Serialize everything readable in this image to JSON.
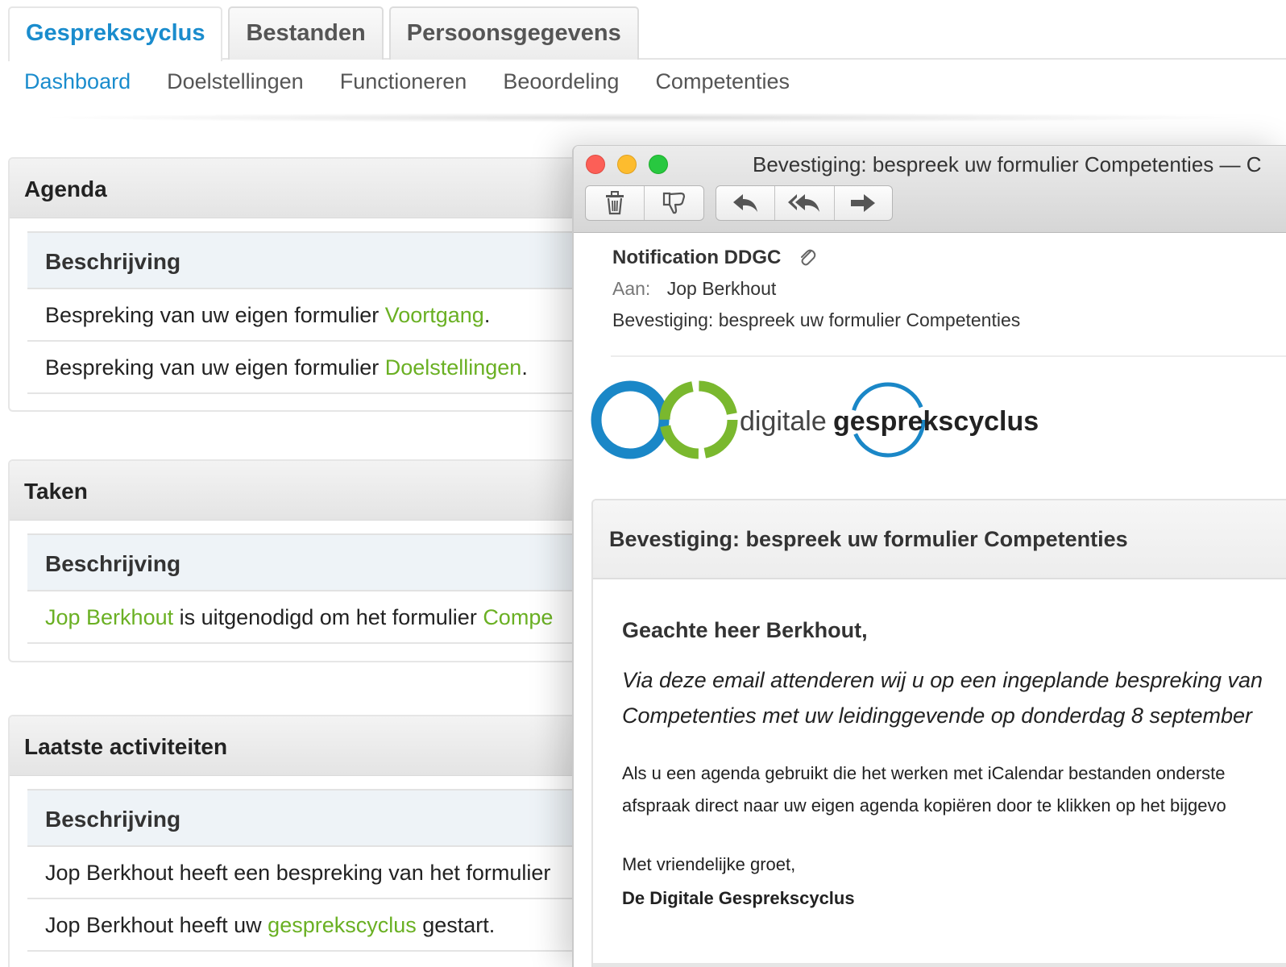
{
  "top_tabs": [
    "Gesprekscyclus",
    "Bestanden",
    "Persoonsgegevens"
  ],
  "sub_nav": [
    "Dashboard",
    "Doelstellingen",
    "Functioneren",
    "Beoordeling",
    "Competenties"
  ],
  "agenda": {
    "title": "Agenda",
    "column": "Beschrijving",
    "row1": {
      "text": "Bespreking van uw eigen formulier ",
      "link": "Voortgang",
      "end": "."
    },
    "row2": {
      "text": "Bespreking van uw eigen formulier ",
      "link": "Doelstellingen",
      "end": "."
    }
  },
  "taken": {
    "title": "Taken",
    "column": "Beschrijving",
    "row1": {
      "link": "Jop Berkhout",
      "text": " is uitgenodigd om het formulier ",
      "link2": "Compe"
    }
  },
  "activiteiten": {
    "title": "Laatste activiteiten",
    "column": "Beschrijving",
    "row1": {
      "text": "Jop Berkhout heeft een bespreking van het formulier"
    },
    "row2": {
      "text": "Jop Berkhout heeft uw ",
      "link": "gesprekscyclus",
      "end": " gestart."
    }
  },
  "mail": {
    "window_title": "Bevestiging: bespreek uw formulier Competenties — C",
    "from": "Notification DDGC",
    "to_label": "Aan:",
    "to": "Jop Berkhout",
    "subject": "Bevestiging: bespreek uw formulier Competenties",
    "logo": {
      "word1": "digitale",
      "word2": "gesprekscyclus"
    },
    "card_title": "Bevestiging: bespreek uw formulier Competenties",
    "greeting": "Geachte heer Berkhout,",
    "intro1": "Via deze email attenderen wij u op een ingeplande bespreking van",
    "intro2": "Competenties met uw leidinggevende op donderdag 8 september",
    "para1": "Als u een agenda gebruikt die het werken met iCalendar bestanden onderste",
    "para2": "afspraak direct naar uw eigen agenda kopiëren door te klikken op het bijgevo",
    "closing": "Met vriendelijke groet,",
    "signature": "De Digitale Gesprekscyclus"
  },
  "colors": {
    "brand_blue": "#1a8ccd",
    "link_green": "#6ab023",
    "logo_blue": "#1a87c7",
    "logo_green": "#7ab82e"
  }
}
